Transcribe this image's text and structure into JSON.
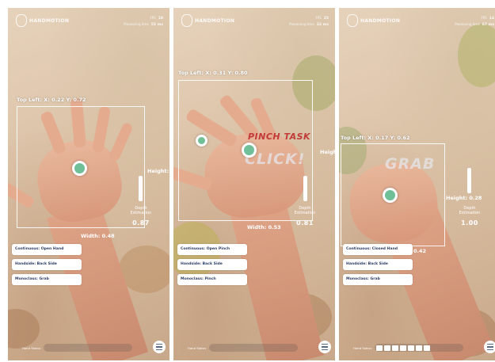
{
  "logo_text": "HANDMOTION",
  "stat_fps_label": "FPS",
  "stat_processing_label": "Processing time",
  "bottom_label": "Hand Status",
  "colors": {
    "point": "#6fbf98",
    "chip_text": "#2c3e66",
    "gesture_top": "#be2d2d"
  },
  "panels": [
    {
      "fps": "18",
      "processing": "55 ms",
      "top_left": "Top Left: X: 0.22 Y: 0.72",
      "height_label": "Height:",
      "depth_caption_1": "Depth",
      "depth_caption_2": "Estimation",
      "depth_value": "0.87",
      "width_label": "Width: 0.48",
      "gesture_top": "",
      "gesture": "",
      "chips": [
        "Continuous: Open Hand",
        "Handside: Back Side",
        "Monoclass: Grab"
      ],
      "status_level": 0.0
    },
    {
      "fps": "25",
      "processing": "32 ms",
      "top_left": "Top Left: X: 0.31 Y: 0.80",
      "height_label": "Height:",
      "depth_caption_1": "Depth",
      "depth_caption_2": "Estimation",
      "depth_value": "0.81",
      "width_label": "Width: 0.53",
      "gesture_top": "PINCH TASK",
      "gesture": "CLICK!",
      "chips": [
        "Continuous: Open Pinch",
        "Handside: Back Side",
        "Monoclass: Pinch"
      ],
      "status_level": 0.0
    },
    {
      "fps": "14",
      "processing": "67 ms",
      "top_left": "Top Left: X: 0.17 Y: 0.62",
      "height_label": "Height: 0.28",
      "depth_caption_1": "Depth",
      "depth_caption_2": "Estimation",
      "depth_value": "1.00",
      "width_label": "0.42",
      "gesture_top": "",
      "gesture": "GRAB",
      "chips": [
        "Continuous: Closed Hand",
        "Handside: Back Side",
        "Monoclass: Grab"
      ],
      "status_level": 1.0
    }
  ]
}
